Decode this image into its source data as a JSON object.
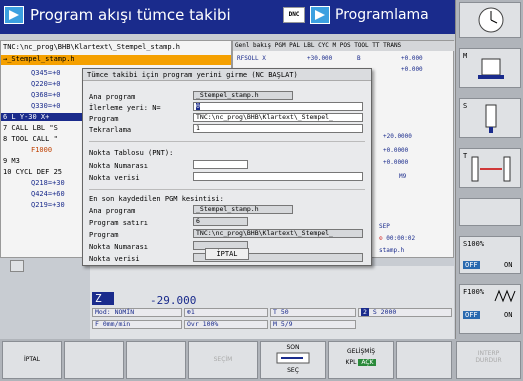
{
  "header": {
    "title": "Program akışı tümce takibi",
    "dnc": "DNC",
    "mode": "Programlama"
  },
  "program": {
    "path": "TNC:\\nc_prog\\BHB\\Klartext\\_Stempel_stamp.h",
    "selected": "→_Stempel_stamp.h",
    "lines": [
      "Q345=+0",
      "Q220=+0",
      "Q368=+0",
      "Q330=+0",
      "6  L  Y-30  X+",
      "7  CALL LBL \"S",
      "8  TOOL CALL \"",
      "F1000",
      "9  M3",
      "10 CYCL DEF 25",
      "Q218=+30",
      "Q424=+60",
      "Q219=+30"
    ]
  },
  "status": {
    "tabs": "Genl bakış PGM PAL LBL CYC M POS TOOL TT TRANS",
    "rfsoll": "RFSOLL  X",
    "x_val": "+30.000",
    "b_lbl": "B",
    "b_val": "+0.000",
    "c_val": "+0.000",
    "v1": "+20.0000",
    "v2": "+0.0000",
    "v3": "+0.0000",
    "m9": "M9",
    "sep": "SEP",
    "time": "00:00:02",
    "file": "stamp.h"
  },
  "dialog": {
    "title": "Tümce takibi için program yerini girme (NC BAŞLAT)",
    "main_program_label": "Ana program",
    "main_program_value": "_Stempel_stamp.h",
    "advance_label": "İlerleme yeri: N=",
    "advance_value": "0",
    "program_label": "Program",
    "program_value": "TNC:\\nc_prog\\BHB\\Klartext\\_Stempel_",
    "repeat_label": "Tekrarlama",
    "repeat_value": "1",
    "point_table_label": "Nokta Tablosu (PNT):",
    "point_number_label": "Nokta Numarası",
    "point_data_label": "Nokta verisi",
    "last_saved_label": "En son kaydedilen PGM kesintisi:",
    "last_main_program_label": "Ana program",
    "last_main_program_value": "_Stempel_stamp.h",
    "program_line_label": "Program satırı",
    "program_line_value": "6",
    "last_program_label": "Program",
    "last_program_value": "TNC:\\nc_prog\\BHB\\Klartext\\_Stempel_",
    "last_point_number_label": "Nokta Numarası",
    "last_point_data_label": "Nokta verisi",
    "cancel_button": "İPTAL"
  },
  "bottom_status": {
    "z_label": "Z",
    "z_value": "-29.000",
    "mod": "Mod: NOMİN",
    "t1": "⊕1",
    "tool": "T 50",
    "spindle_badge": "2",
    "spindle": "S 2000",
    "feed": "F 0mm/min",
    "ovr": "Ovr 100%",
    "m": "M 5/9"
  },
  "right_softkeys": {
    "s_label": "S100%",
    "off1": "OFF",
    "on1": "ON",
    "f_label": "F100%",
    "off2": "OFF",
    "on2": "ON"
  },
  "softkeys": {
    "cancel": "İPTAL",
    "secim": "SEÇİM",
    "son": "SON",
    "sec": "SEÇ",
    "gelismis": "GELİŞMİŞ",
    "kpl": "KPL",
    "ack": "AÇK",
    "interp": "INTERP",
    "durdur": "DURDUR"
  },
  "colors": {
    "header": "#1a2b8c",
    "highlight": "#f5a000",
    "accent_green": "#2a8a3a"
  }
}
